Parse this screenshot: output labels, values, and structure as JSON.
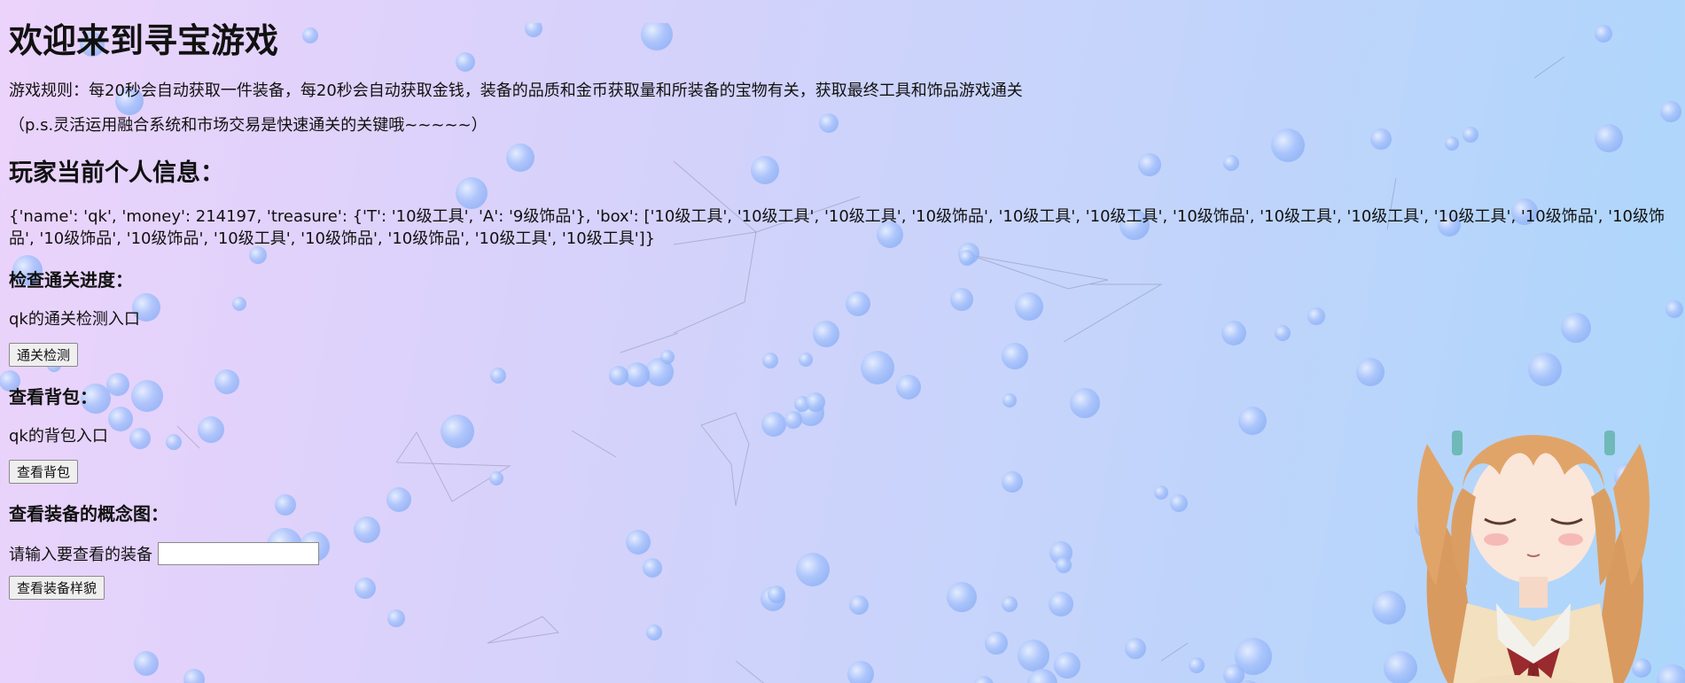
{
  "page": {
    "title": "欢迎来到寻宝游戏",
    "rules": "游戏规则：每20秒会自动获取一件装备，每20秒会自动获取金钱，装备的品质和金币获取量和所装备的宝物有关，获取最终工具和饰品游戏通关",
    "note": "（p.s.灵活运用融合系统和市场交易是快速通关的关键哦~~~~~）"
  },
  "player": {
    "heading": "玩家当前个人信息：",
    "info": "{'name': 'qk', 'money': 214197, 'treasure': {'T': '10级工具', 'A': '9级饰品'}, 'box': ['10级工具', '10级工具', '10级工具', '10级饰品', '10级工具', '10级工具', '10级饰品', '10级工具', '10级工具', '10级工具', '10级饰品', '10级饰品', '10级饰品', '10级饰品', '10级工具', '10级饰品', '10级饰品', '10级工具', '10级工具']}"
  },
  "progress": {
    "heading": "检查通关进度：",
    "entry": "qk的通关检测入口",
    "button": "通关检测"
  },
  "backpack": {
    "heading": "查看背包：",
    "entry": "qk的背包入口",
    "button": "查看背包"
  },
  "equipment": {
    "heading": "查看装备的概念图：",
    "label": "请输入要查看的装备",
    "input_value": "",
    "button": "查看装备样貌"
  },
  "colors": {
    "bubble": "#9ec4fb",
    "gradient_left": "#ecd3fb",
    "gradient_right": "#acd6fb"
  }
}
